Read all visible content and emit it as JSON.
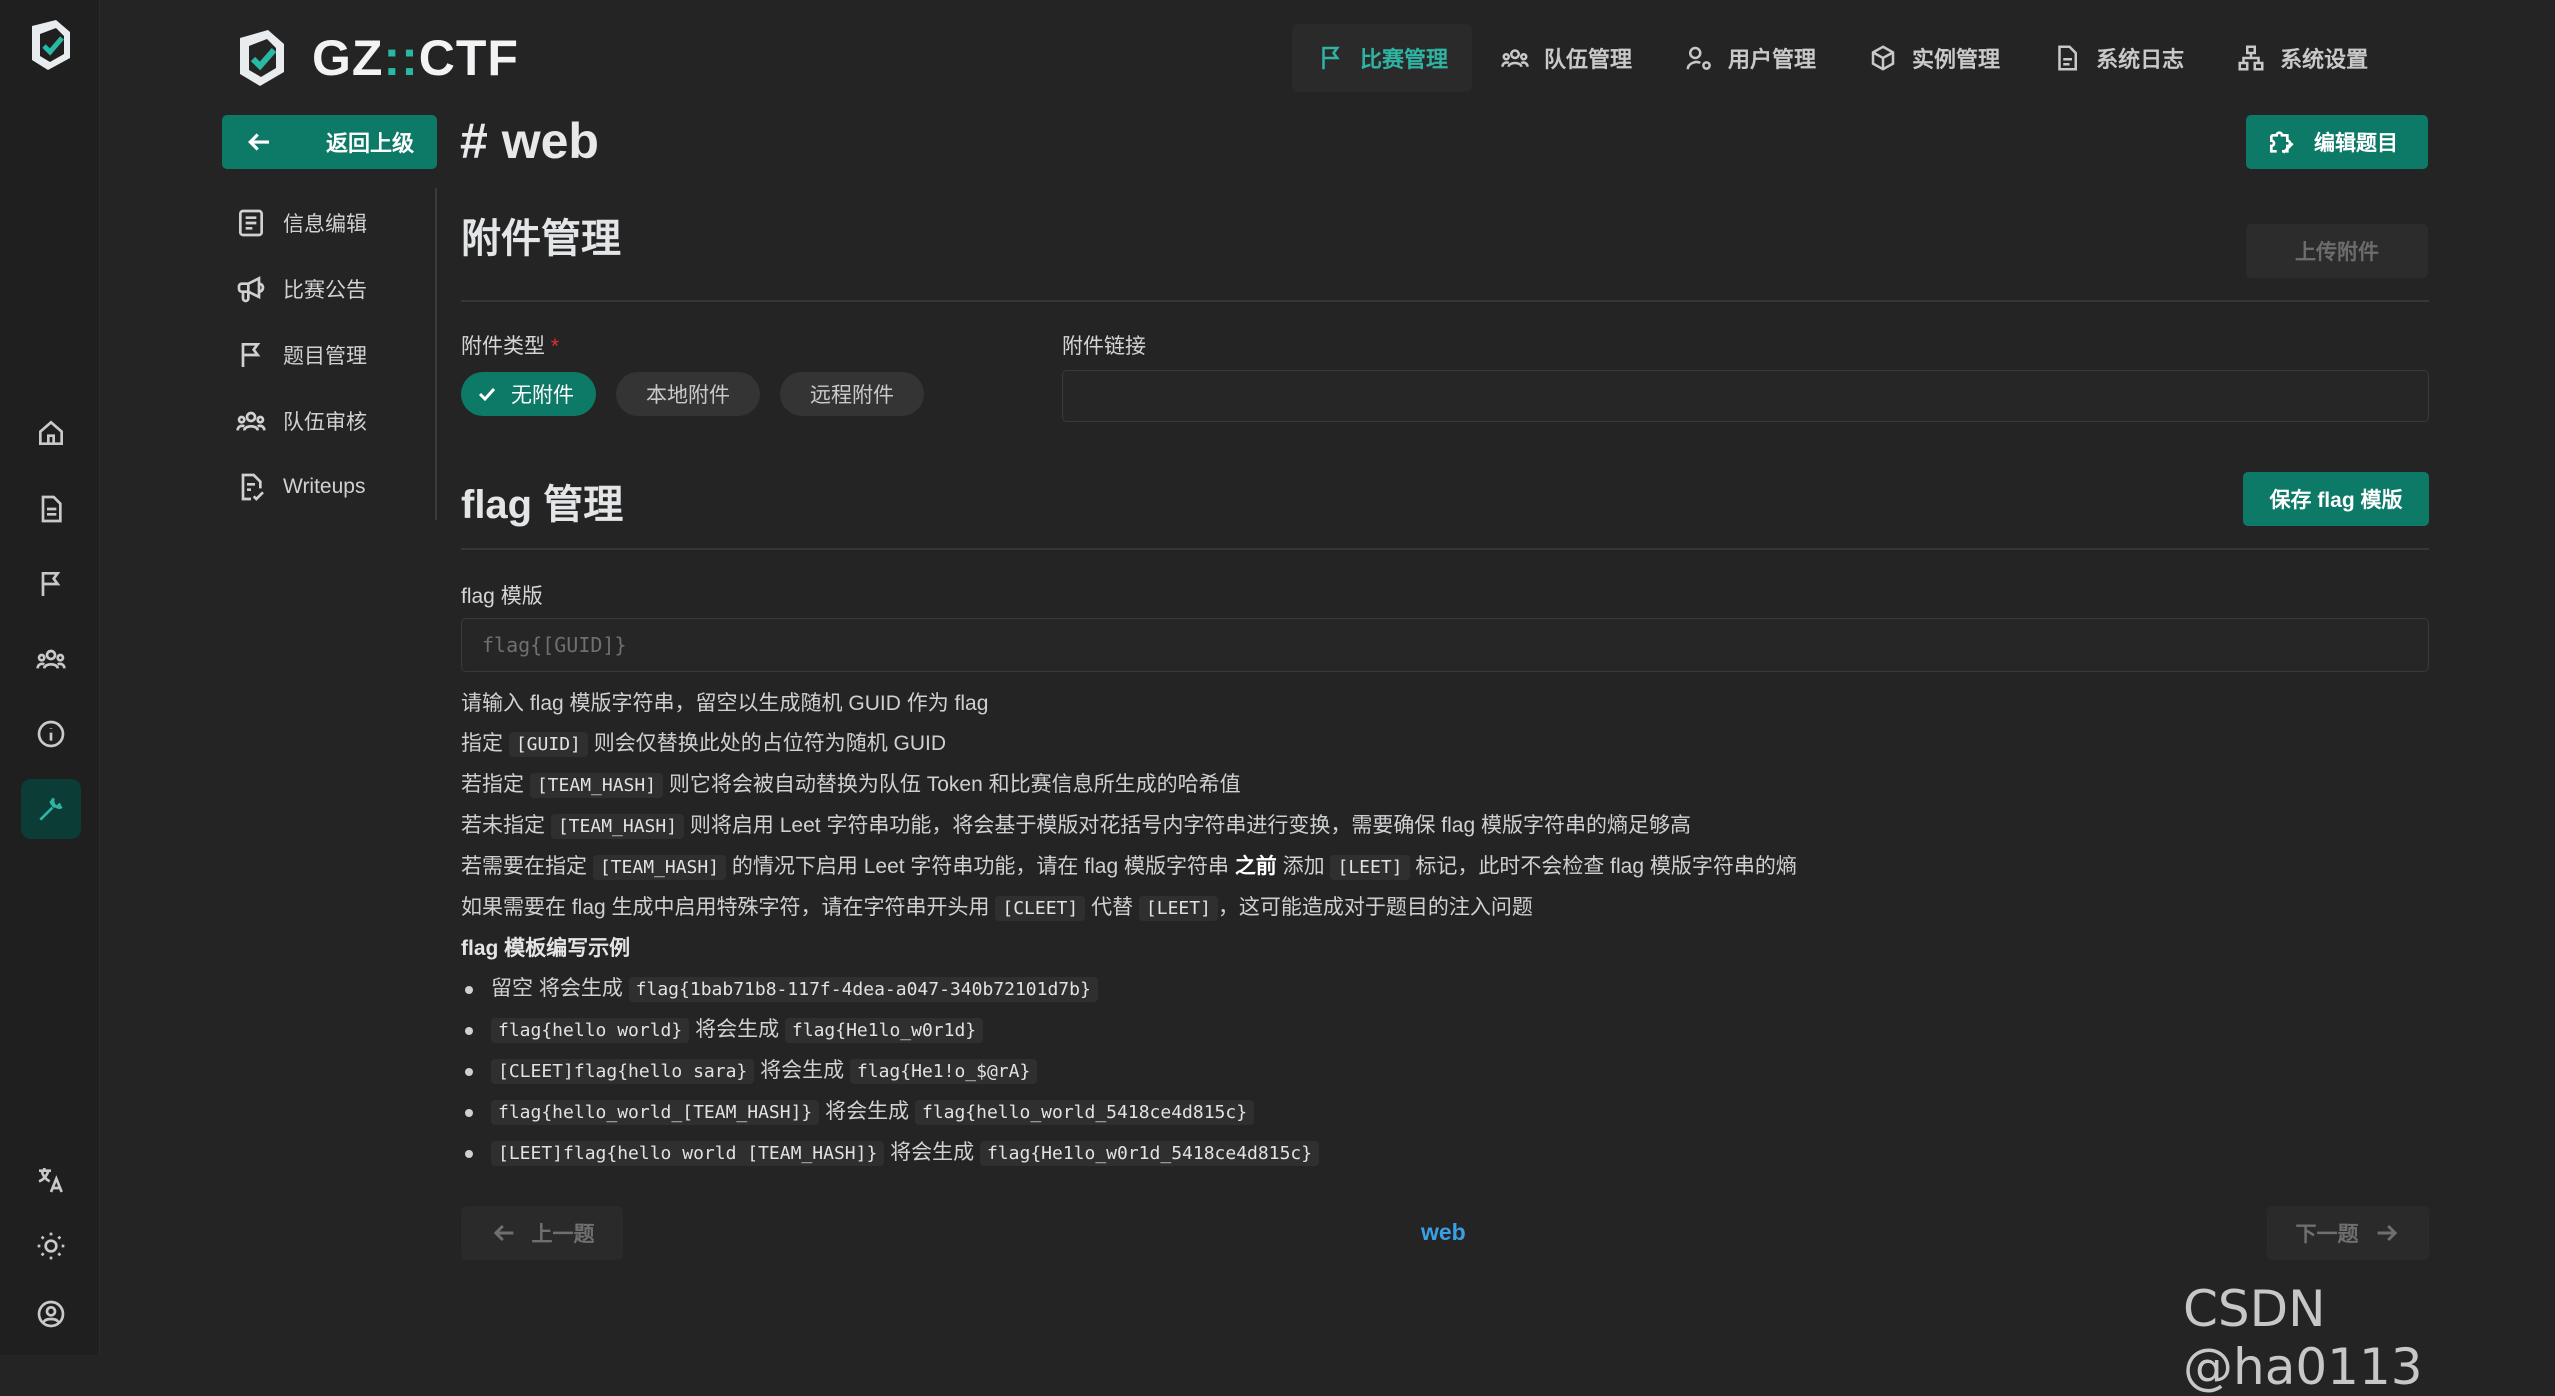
{
  "brand": {
    "name_left": "GZ",
    "name_sep": "::",
    "name_right": "CTF"
  },
  "rail": {
    "items": [
      {
        "icon": "home-icon"
      },
      {
        "icon": "document-icon"
      },
      {
        "icon": "flag-icon"
      },
      {
        "icon": "users-icon"
      },
      {
        "icon": "info-icon"
      },
      {
        "icon": "wrench-icon",
        "active": true
      }
    ],
    "bottom": [
      {
        "icon": "translate-icon"
      },
      {
        "icon": "sun-icon"
      },
      {
        "icon": "user-circle-icon"
      }
    ]
  },
  "topnav": {
    "items": [
      {
        "label": "比赛管理",
        "icon": "flag-icon",
        "active": true
      },
      {
        "label": "队伍管理",
        "icon": "users-icon"
      },
      {
        "label": "用户管理",
        "icon": "user-cog-icon"
      },
      {
        "label": "实例管理",
        "icon": "box-icon"
      },
      {
        "label": "系统日志",
        "icon": "file-icon"
      },
      {
        "label": "系统设置",
        "icon": "hierarchy-icon"
      }
    ]
  },
  "header": {
    "back_label": "返回上级",
    "title": "# web",
    "edit_label": "编辑题目"
  },
  "subnav": {
    "items": [
      {
        "label": "信息编辑",
        "icon": "list-icon"
      },
      {
        "label": "比赛公告",
        "icon": "speakerphone-icon"
      },
      {
        "label": "题目管理",
        "icon": "flag-icon"
      },
      {
        "label": "队伍审核",
        "icon": "users-icon"
      },
      {
        "label": "Writeups",
        "icon": "file-check-icon"
      }
    ]
  },
  "attachments": {
    "title": "附件管理",
    "upload_label": "上传附件",
    "type_label": "附件类型",
    "required_mark": "*",
    "types": [
      {
        "label": "无附件",
        "active": true
      },
      {
        "label": "本地附件"
      },
      {
        "label": "远程附件"
      }
    ],
    "link_label": "附件链接",
    "link_value": ""
  },
  "flag": {
    "title": "flag 管理",
    "save_label": "保存 flag 模版",
    "template_label": "flag 模版",
    "template_placeholder": "flag{[GUID]}",
    "desc": [
      {
        "parts": [
          "请输入 flag 模版字符串，留空以生成随机 GUID 作为 flag"
        ]
      },
      {
        "parts": [
          "指定 ",
          "[GUID]",
          " 则会仅替换此处的占位符为随机 GUID"
        ]
      },
      {
        "parts": [
          "若指定 ",
          "[TEAM_HASH]",
          " 则它将会被自动替换为队伍 Token 和比赛信息所生成的哈希值"
        ]
      },
      {
        "parts": [
          "若未指定 ",
          "[TEAM_HASH]",
          " 则将启用 Leet 字符串功能，将会基于模版对花括号内字符串进行变换，需要确保 flag 模版字符串的熵足够高"
        ]
      },
      {
        "parts": [
          "若需要在指定 ",
          "[TEAM_HASH]",
          " 的情况下启用 Leet 字符串功能，请在 flag 模版字符串 ",
          "之前",
          " 添加 ",
          "[LEET]",
          " 标记，此时不会检查 flag 模版字符串的熵"
        ]
      },
      {
        "parts": [
          "如果需要在 flag 生成中启用特殊字符，请在字符串开头用 ",
          "[CLEET]",
          " 代替 ",
          "[LEET]",
          "，这可能造成对于题目的注入问题"
        ]
      }
    ],
    "example_title": "flag 模板编写示例",
    "examples": [
      {
        "input": "",
        "prefix": "留空 将会生成 ",
        "output": "flag{1bab71b8-117f-4dea-a047-340b72101d7b}"
      },
      {
        "input": "flag{hello world}",
        "prefix": " 将会生成 ",
        "output": "flag{He1lo_w0r1d}"
      },
      {
        "input": "[CLEET]flag{hello sara}",
        "prefix": " 将会生成 ",
        "output": "flag{He1!o_$@rA}"
      },
      {
        "input": "flag{hello_world_[TEAM_HASH]}",
        "prefix": " 将会生成 ",
        "output": "flag{hello_world_5418ce4d815c}"
      },
      {
        "input": "[LEET]flag{hello world [TEAM_HASH]}",
        "prefix": " 将会生成 ",
        "output": "flag{He1lo_w0r1d_5418ce4d815c}"
      }
    ]
  },
  "pager": {
    "prev_label": "上一题",
    "current": "web",
    "next_label": "下一题"
  },
  "watermark": "CSDN @ha0113",
  "colors": {
    "accent": "#0d7a67",
    "accent_text": "#2fb3a2",
    "link": "#3aa0e6",
    "background": "#242424"
  }
}
